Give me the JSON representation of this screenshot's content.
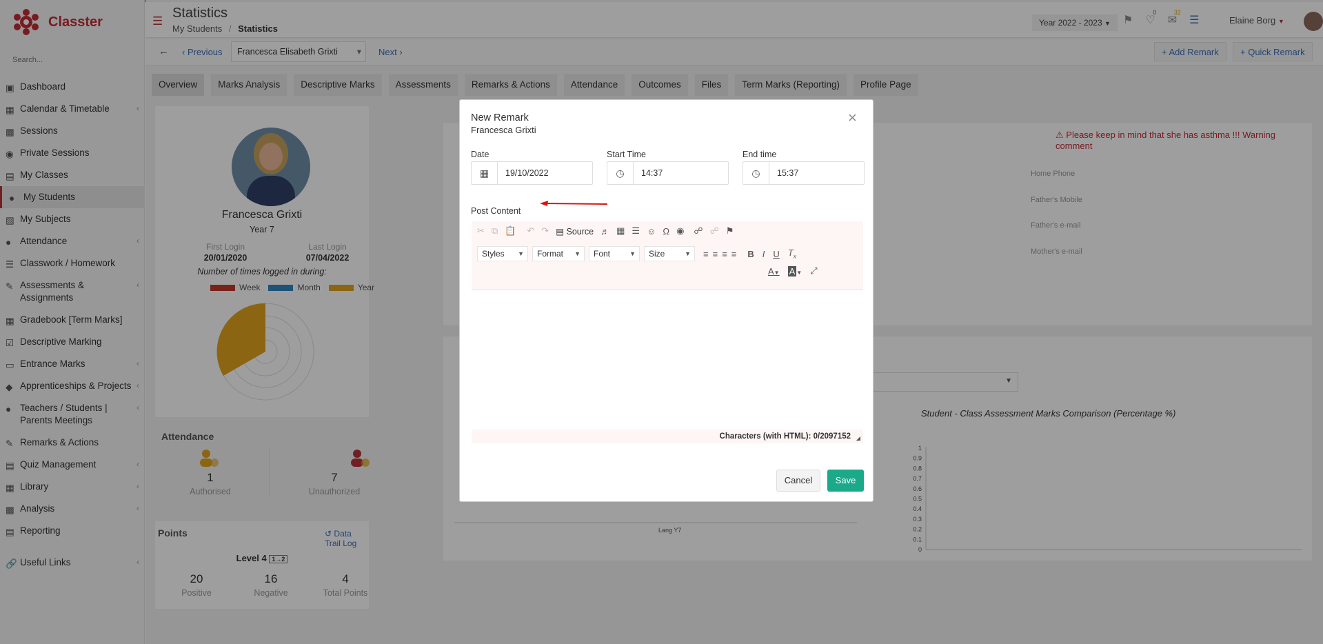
{
  "app": {
    "name": "Classter"
  },
  "sidebar": {
    "search_placeholder": "Search...",
    "items": [
      {
        "label": "Dashboard",
        "chevron": false
      },
      {
        "label": "Calendar & Timetable",
        "chevron": true
      },
      {
        "label": "Sessions",
        "chevron": false
      },
      {
        "label": "Private Sessions",
        "chevron": false
      },
      {
        "label": "My Classes",
        "chevron": false
      },
      {
        "label": "My Students",
        "chevron": false,
        "active": true
      },
      {
        "label": "My Subjects",
        "chevron": false
      },
      {
        "label": "Attendance",
        "chevron": true
      },
      {
        "label": "Classwork / Homework",
        "chevron": false
      },
      {
        "label": "Assessments & Assignments",
        "chevron": true
      },
      {
        "label": "Gradebook [Term Marks]",
        "chevron": false
      },
      {
        "label": "Descriptive Marking",
        "chevron": false
      },
      {
        "label": "Entrance Marks",
        "chevron": true
      },
      {
        "label": "Apprenticeships & Projects",
        "chevron": true
      },
      {
        "label": "Teachers / Students | Parents Meetings",
        "chevron": true
      },
      {
        "label": "Remarks & Actions",
        "chevron": false
      },
      {
        "label": "Quiz Management",
        "chevron": true
      },
      {
        "label": "Library",
        "chevron": true
      },
      {
        "label": "Analysis",
        "chevron": true
      },
      {
        "label": "Reporting",
        "chevron": false
      },
      {
        "label": "Useful Links",
        "chevron": true
      }
    ]
  },
  "header": {
    "title": "Statistics",
    "breadcrumb": {
      "parent": "My Students",
      "separator": "/",
      "current": "Statistics"
    },
    "year": "Year 2022 - 2023",
    "notif_count": "0",
    "mail_count": "32",
    "user": "Elaine Borg"
  },
  "subbar": {
    "previous": "Previous",
    "student_select": "Francesca Elisabeth Grixti",
    "next": "Next",
    "add_remark": "Add Remark",
    "quick_remark": "Quick Remark"
  },
  "tabs": [
    "Overview",
    "Marks Analysis",
    "Descriptive Marks",
    "Assessments",
    "Remarks & Actions",
    "Attendance",
    "Outcomes",
    "Files",
    "Term Marks (Reporting)",
    "Profile Page"
  ],
  "student": {
    "name": "Francesca Grixti",
    "year": "Year 7",
    "first_login_label": "First Login",
    "first_login": "20/01/2020",
    "last_login_label": "Last Login",
    "last_login": "07/04/2022",
    "logged_caption": "Number of times logged in during:",
    "legend": [
      {
        "label": "Week",
        "color": "#c0392b"
      },
      {
        "label": "Month",
        "color": "#2e86c1"
      },
      {
        "label": "Year",
        "color": "#e0a31e"
      }
    ]
  },
  "warning": "Please keep in mind that she has asthma !!! Warning comment",
  "contacts": [
    "Home Phone",
    "Father's Mobile",
    "Father's e-mail",
    "Mother's e-mail"
  ],
  "attendance": {
    "title": "Attendance",
    "authorised": "1",
    "authorised_label": "Authorised",
    "unauthorized": "7",
    "unauthorized_label": "Unauthorized"
  },
  "points": {
    "title": "Points",
    "trail": "Data Trail Log",
    "level": "Level 4",
    "positive": "20",
    "positive_label": "Positive",
    "negative": "16",
    "negative_label": "Negative",
    "total": "4",
    "total_label": "Total Points"
  },
  "chart": {
    "title": "Student - Class Assessment Marks Comparison (Percentage %)",
    "x_label": "Lang Y7",
    "ticks": [
      "1",
      "0.9",
      "0.8",
      "0.7",
      "0.6",
      "0.5",
      "0.4",
      "0.3",
      "0.2",
      "0.1",
      "0"
    ]
  },
  "modal": {
    "title": "New Remark",
    "subtitle": "Francesca Grixti",
    "date_label": "Date",
    "date": "19/10/2022",
    "start_label": "Start Time",
    "start": "14:37",
    "end_label": "End time",
    "end": "15:37",
    "content_label": "Post Content",
    "source": "Source",
    "styles": "Styles",
    "format": "Format",
    "font": "Font",
    "size": "Size",
    "status": "Characters (with HTML): 0/2097152",
    "cancel": "Cancel",
    "save": "Save"
  }
}
